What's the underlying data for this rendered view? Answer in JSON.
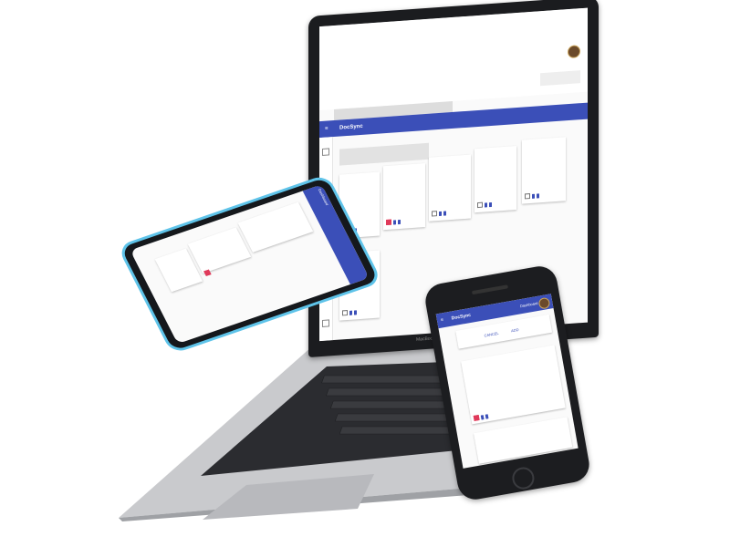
{
  "app": {
    "name": "DocSync"
  },
  "laptop": {
    "user_name": "",
    "brand": "MacBook",
    "new_note_placeholder": "",
    "cards": [
      {
        "timestamp": "",
        "text": ""
      },
      {
        "timestamp": "",
        "text": ""
      },
      {
        "timestamp": "",
        "text": ""
      },
      {
        "timestamp": "",
        "text": ""
      },
      {
        "timestamp": "",
        "text": ""
      },
      {
        "timestamp": "",
        "text": ""
      }
    ]
  },
  "phone_right": {
    "dashboard_label": "Dashboard",
    "cancel_label": "CANCEL",
    "add_label": "ADD",
    "cards": [
      {
        "timestamp": "",
        "text": ""
      },
      {
        "timestamp": "",
        "text": ""
      }
    ]
  },
  "phone_left": {
    "dashboard_label": "Dashboard"
  },
  "colors": {
    "primary": "#3b4fb8",
    "accent": "#e03a5a",
    "phone_frame": "#5ec3e9"
  }
}
